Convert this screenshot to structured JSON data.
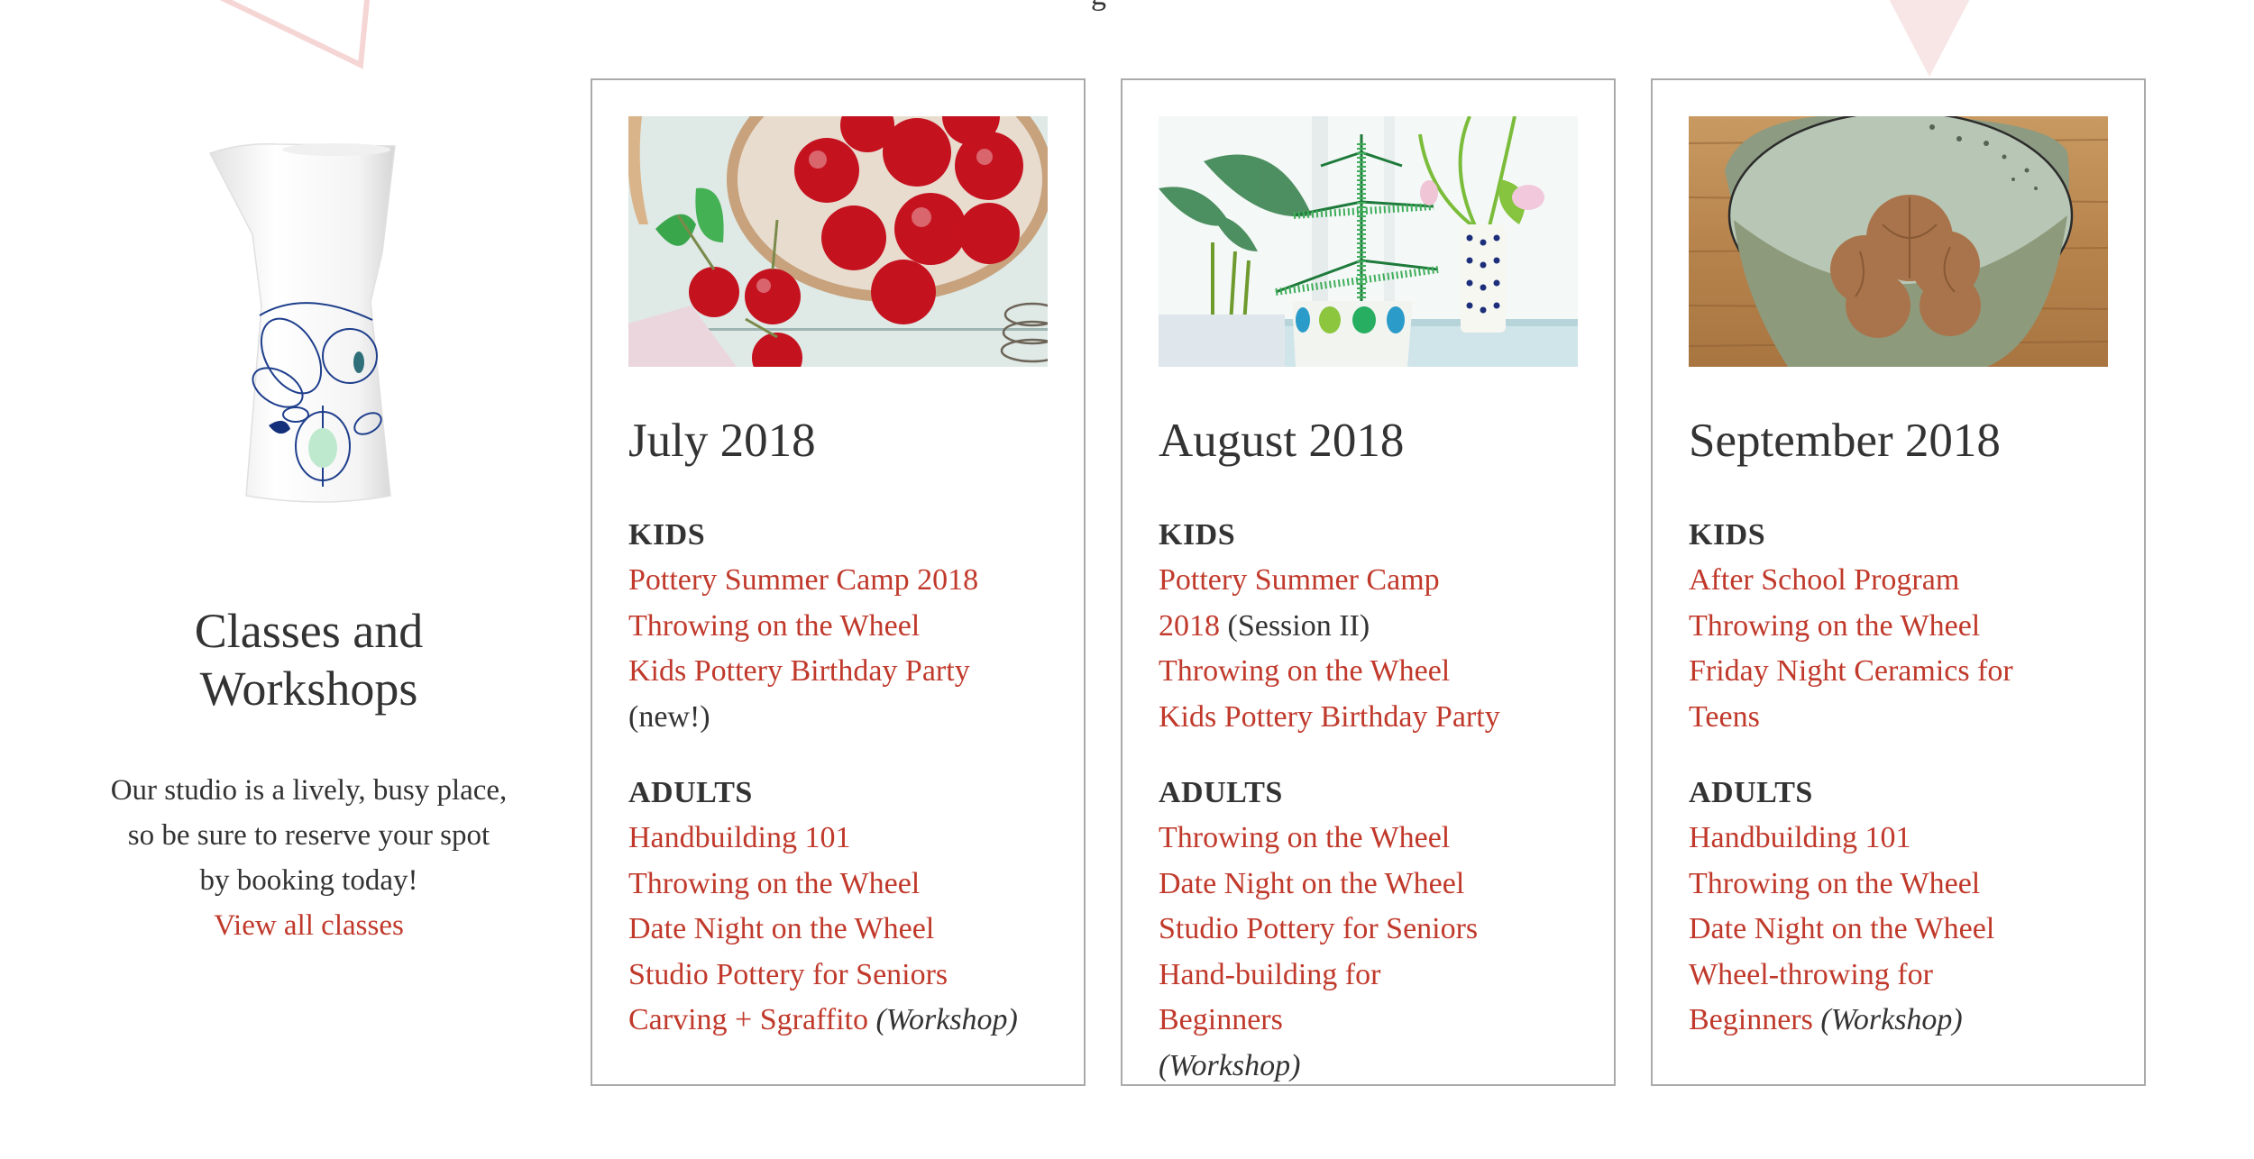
{
  "colors": {
    "link": "#c0392b",
    "text": "#333333",
    "card_border": "#aaaaaa",
    "accent_pink": "#f6d5d5"
  },
  "decorations": {
    "top_glyph": "g"
  },
  "intro": {
    "image_icon": "pitcher-illustration",
    "title": "Classes and Workshops",
    "description": "Our studio is a lively, busy place, so be sure to reserve your spot by booking today!",
    "view_all_link": "View all classes"
  },
  "months": [
    {
      "title": "July 2018",
      "image": "cherries-in-bowl-photo",
      "kids_label": "KIDS",
      "kids": [
        {
          "label": "Pottery Summer Camp 2018",
          "note": ""
        },
        {
          "label": "Throwing on the Wheel",
          "note": ""
        },
        {
          "label": "Kids Pottery Birthday Party",
          "note": "(new!)"
        }
      ],
      "adults_label": "ADULTS",
      "adults": [
        {
          "label": "Handbuilding 101",
          "note": ""
        },
        {
          "label": "Throwing on the Wheel",
          "note": ""
        },
        {
          "label": "Date Night on the Wheel",
          "note": ""
        },
        {
          "label": "Studio Pottery for Seniors",
          "note": ""
        },
        {
          "label": "Carving + Sgraffito",
          "note": "(Workshop)"
        }
      ]
    },
    {
      "title": "August 2018",
      "image": "potted-plants-window-photo",
      "kids_label": "KIDS",
      "kids": [
        {
          "label": "Pottery Summer Camp 2018",
          "note": "(Session II)"
        },
        {
          "label": "Throwing on the Wheel",
          "note": ""
        },
        {
          "label": "Kids Pottery Birthday Party",
          "note": ""
        }
      ],
      "adults_label": "ADULTS",
      "adults": [
        {
          "label": "Throwing on the Wheel",
          "note": ""
        },
        {
          "label": "Date Night on the Wheel",
          "note": ""
        },
        {
          "label": "Studio Pottery for Seniors",
          "note": ""
        },
        {
          "label": "Hand-building for Beginners",
          "note": "(Workshop)"
        }
      ]
    },
    {
      "title": "September 2018",
      "image": "walnuts-in-bowl-photo",
      "kids_label": "KIDS",
      "kids": [
        {
          "label": "After School Program",
          "note": ""
        },
        {
          "label": "Throwing on the Wheel",
          "note": ""
        },
        {
          "label": "Friday Night Ceramics for Teens",
          "note": ""
        }
      ],
      "adults_label": "ADULTS",
      "adults": [
        {
          "label": "Handbuilding 101",
          "note": ""
        },
        {
          "label": "Throwing on the Wheel",
          "note": ""
        },
        {
          "label": "Date Night on the Wheel",
          "note": ""
        },
        {
          "label": "Wheel-throwing for Beginners",
          "note": "(Workshop)"
        }
      ]
    }
  ]
}
